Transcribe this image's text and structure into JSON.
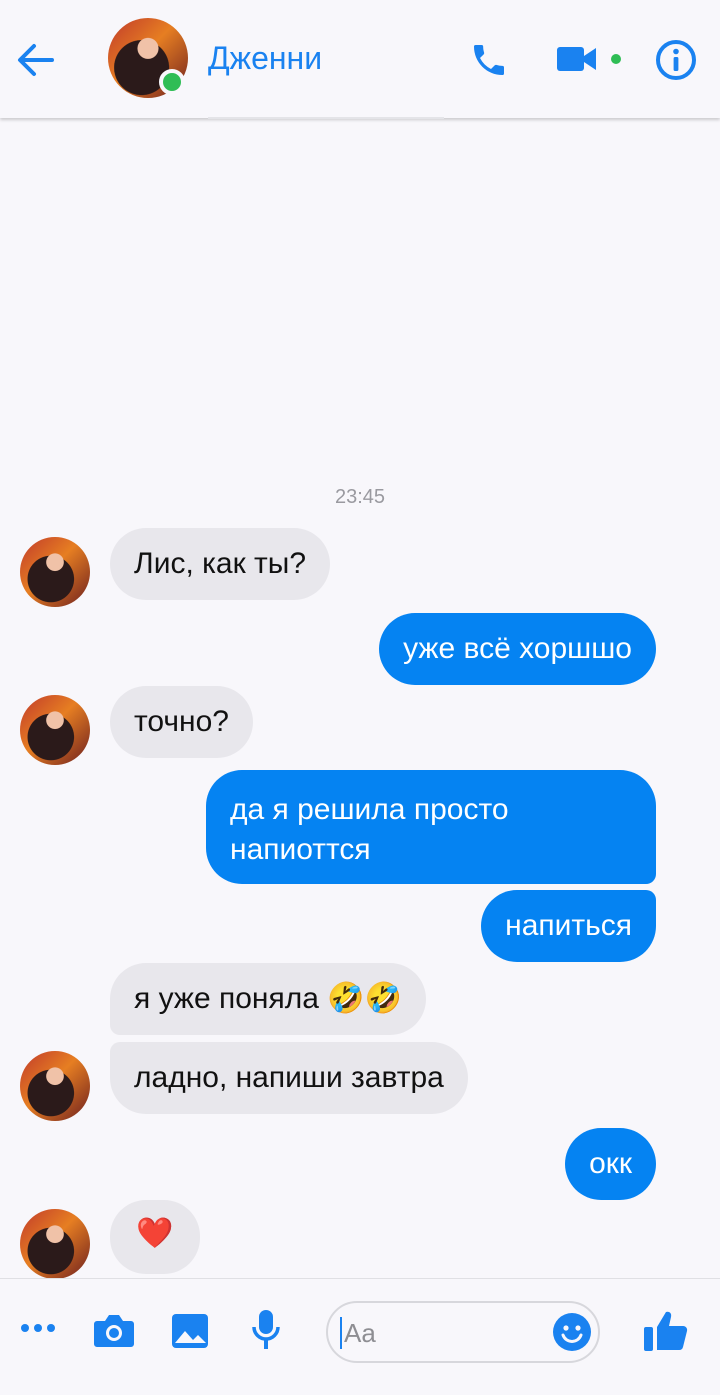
{
  "header": {
    "contact_name": "Дженни"
  },
  "chat": {
    "timestamp": "23:45",
    "messages": [
      {
        "from": "them",
        "text": "Лис, как ты?"
      },
      {
        "from": "me",
        "text": "уже всё хоршшо"
      },
      {
        "from": "them",
        "text": "точно?"
      },
      {
        "from": "me",
        "text": "да я решила просто",
        "text2": "напиоттся"
      },
      {
        "from": "me",
        "text": "напиться"
      },
      {
        "from": "them",
        "text": "я уже поняла 🤣🤣"
      },
      {
        "from": "them",
        "text": "ладно, напиши завтра"
      },
      {
        "from": "me",
        "text": "окк"
      },
      {
        "from": "them",
        "text": "❤️"
      }
    ]
  },
  "composer": {
    "placeholder": "Aa"
  },
  "colors": {
    "accent": "#0583f2",
    "online": "#2fbd55"
  }
}
